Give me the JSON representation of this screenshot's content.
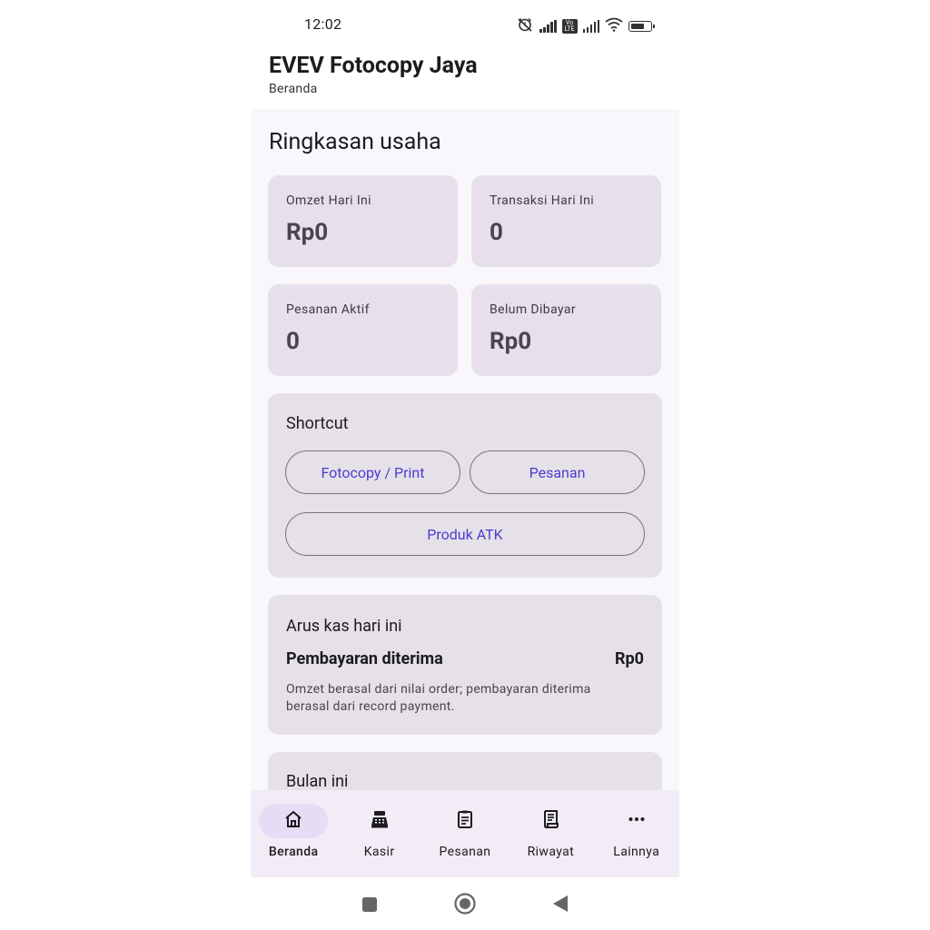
{
  "status_bar": {
    "time": "12:02",
    "volte": "Vo LTE"
  },
  "header": {
    "title": "EVEV Fotocopy Jaya",
    "subtitle": "Beranda"
  },
  "summary": {
    "title": "Ringkasan usaha",
    "cards": [
      {
        "label": "Omzet Hari Ini",
        "value": "Rp0"
      },
      {
        "label": "Transaksi Hari Ini",
        "value": "0"
      },
      {
        "label": "Pesanan Aktif",
        "value": "0"
      },
      {
        "label": "Belum Dibayar",
        "value": "Rp0"
      }
    ]
  },
  "shortcut": {
    "title": "Shortcut",
    "buttons": [
      "Fotocopy / Print",
      "Pesanan",
      "Produk ATK"
    ]
  },
  "cashflow": {
    "title": "Arus kas hari ini",
    "label": "Pembayaran diterima",
    "value": "Rp0",
    "note": "Omzet berasal dari nilai order; pembayaran diterima berasal dari record payment."
  },
  "month": {
    "title": "Bulan ini"
  },
  "bottom_nav": {
    "items": [
      {
        "label": "Beranda",
        "icon": "home-icon"
      },
      {
        "label": "Kasir",
        "icon": "cash-register-icon"
      },
      {
        "label": "Pesanan",
        "icon": "clipboard-icon"
      },
      {
        "label": "Riwayat",
        "icon": "receipt-icon"
      },
      {
        "label": "Lainnya",
        "icon": "more-horiz-icon"
      }
    ],
    "active_index": 0
  },
  "colors": {
    "accent_text": "#4a3ccf",
    "card_bg": "#e7e0ec",
    "nav_bg": "#f2ecf6",
    "active_pill": "#e7dcf6"
  }
}
